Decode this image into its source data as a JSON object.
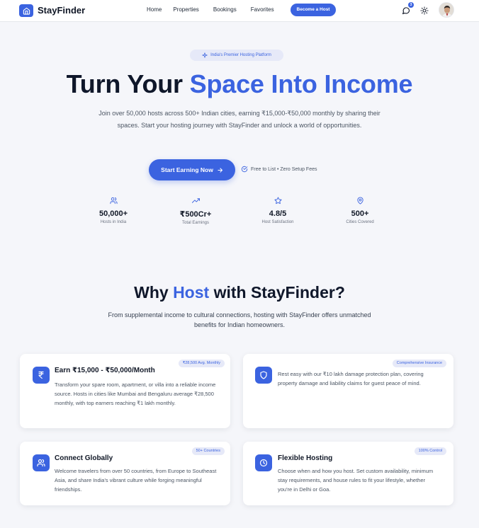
{
  "nav": {
    "brand": "StayFinder",
    "links": [
      "Home",
      "Properties",
      "Bookings",
      "Favorites"
    ],
    "host_button": "Become a Host",
    "chat_badge": "3",
    "icons": [
      "home-icon",
      "chat-icon",
      "sun-icon"
    ],
    "accent": "#3b63e0"
  },
  "hero": {
    "badge": "India's Premier Hosting Platform",
    "title_a": "Turn Your ",
    "title_b": "Space Into Income",
    "subtitle": "Join over 50,000 hosts across 500+ Indian cities, earning ₹15,000-₹50,000 monthly by sharing their spaces. Start your hosting journey with StayFinder and unlock a world of opportunities.",
    "cta": "Start Earning Now",
    "note": "Free to List • Zero Setup Fees"
  },
  "stats": [
    {
      "value": "50,000+",
      "label": "Hosts in India",
      "icon": "users-icon"
    },
    {
      "value": "₹500Cr+",
      "label": "Total Earnings",
      "icon": "trending-up-icon"
    },
    {
      "value": "4.8/5",
      "label": "Host Satisfaction",
      "icon": "star-icon"
    },
    {
      "value": "500+",
      "label": "Cities Covered",
      "icon": "map-pin-icon"
    }
  ],
  "why": {
    "title_a": "Why ",
    "title_b": "Host",
    "title_c": " with StayFinder?",
    "subtitle": "From supplemental income to cultural connections, hosting with StayFinder offers unmatched benefits for Indian homeowners."
  },
  "cards": [
    {
      "title": "Earn ₹15,000 - ₹50,000/Month",
      "tag": "₹28,500 Avg. Monthly",
      "body": "Transform your spare room, apartment, or villa into a reliable income source. Hosts in cities like Mumbai and Bengaluru average ₹28,500 monthly, with top earners reaching ₹1 lakh monthly.",
      "icon": "rupee-icon"
    },
    {
      "title": "",
      "tag": "Comprehensive Insurance",
      "body": "Rest easy with our ₹10 lakh damage protection plan, covering property damage and liability claims for guest peace of mind.",
      "icon": "shield-icon"
    },
    {
      "title": "Connect Globally",
      "tag": "50+ Countries",
      "body": "Welcome travelers from over 50 countries, from Europe to Southeast Asia, and share India's vibrant culture while forging meaningful friendships.",
      "icon": "users-icon"
    },
    {
      "title": "Flexible Hosting",
      "tag": "100% Control",
      "body": "Choose when and how you host. Set custom availability, minimum stay requirements, and house rules to fit your lifestyle, whether you're in Delhi or Goa.",
      "icon": "clock-icon"
    }
  ]
}
